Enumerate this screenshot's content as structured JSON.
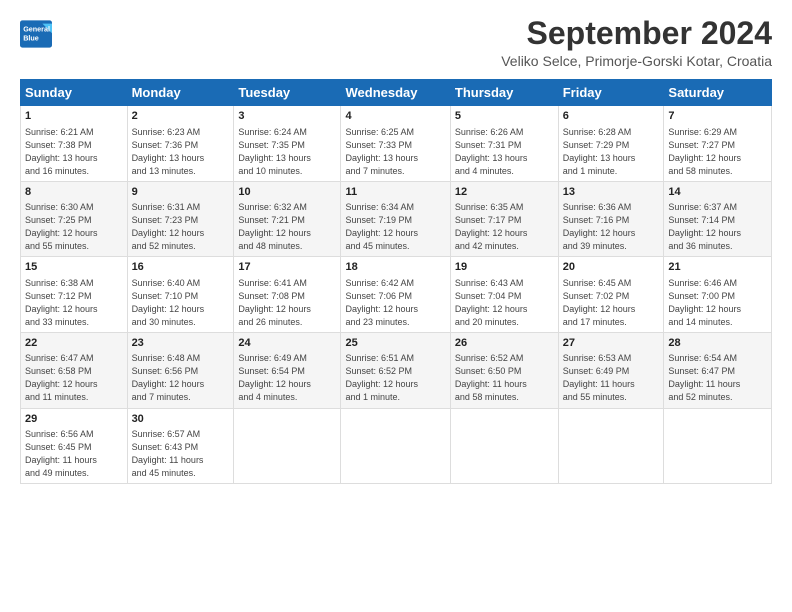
{
  "header": {
    "logo_line1": "General",
    "logo_line2": "Blue",
    "month_title": "September 2024",
    "location": "Veliko Selce, Primorje-Gorski Kotar, Croatia"
  },
  "days_of_week": [
    "Sunday",
    "Monday",
    "Tuesday",
    "Wednesday",
    "Thursday",
    "Friday",
    "Saturday"
  ],
  "weeks": [
    [
      {
        "day": "1",
        "info": "Sunrise: 6:21 AM\nSunset: 7:38 PM\nDaylight: 13 hours\nand 16 minutes."
      },
      {
        "day": "2",
        "info": "Sunrise: 6:23 AM\nSunset: 7:36 PM\nDaylight: 13 hours\nand 13 minutes."
      },
      {
        "day": "3",
        "info": "Sunrise: 6:24 AM\nSunset: 7:35 PM\nDaylight: 13 hours\nand 10 minutes."
      },
      {
        "day": "4",
        "info": "Sunrise: 6:25 AM\nSunset: 7:33 PM\nDaylight: 13 hours\nand 7 minutes."
      },
      {
        "day": "5",
        "info": "Sunrise: 6:26 AM\nSunset: 7:31 PM\nDaylight: 13 hours\nand 4 minutes."
      },
      {
        "day": "6",
        "info": "Sunrise: 6:28 AM\nSunset: 7:29 PM\nDaylight: 13 hours\nand 1 minute."
      },
      {
        "day": "7",
        "info": "Sunrise: 6:29 AM\nSunset: 7:27 PM\nDaylight: 12 hours\nand 58 minutes."
      }
    ],
    [
      {
        "day": "8",
        "info": "Sunrise: 6:30 AM\nSunset: 7:25 PM\nDaylight: 12 hours\nand 55 minutes."
      },
      {
        "day": "9",
        "info": "Sunrise: 6:31 AM\nSunset: 7:23 PM\nDaylight: 12 hours\nand 52 minutes."
      },
      {
        "day": "10",
        "info": "Sunrise: 6:32 AM\nSunset: 7:21 PM\nDaylight: 12 hours\nand 48 minutes."
      },
      {
        "day": "11",
        "info": "Sunrise: 6:34 AM\nSunset: 7:19 PM\nDaylight: 12 hours\nand 45 minutes."
      },
      {
        "day": "12",
        "info": "Sunrise: 6:35 AM\nSunset: 7:17 PM\nDaylight: 12 hours\nand 42 minutes."
      },
      {
        "day": "13",
        "info": "Sunrise: 6:36 AM\nSunset: 7:16 PM\nDaylight: 12 hours\nand 39 minutes."
      },
      {
        "day": "14",
        "info": "Sunrise: 6:37 AM\nSunset: 7:14 PM\nDaylight: 12 hours\nand 36 minutes."
      }
    ],
    [
      {
        "day": "15",
        "info": "Sunrise: 6:38 AM\nSunset: 7:12 PM\nDaylight: 12 hours\nand 33 minutes."
      },
      {
        "day": "16",
        "info": "Sunrise: 6:40 AM\nSunset: 7:10 PM\nDaylight: 12 hours\nand 30 minutes."
      },
      {
        "day": "17",
        "info": "Sunrise: 6:41 AM\nSunset: 7:08 PM\nDaylight: 12 hours\nand 26 minutes."
      },
      {
        "day": "18",
        "info": "Sunrise: 6:42 AM\nSunset: 7:06 PM\nDaylight: 12 hours\nand 23 minutes."
      },
      {
        "day": "19",
        "info": "Sunrise: 6:43 AM\nSunset: 7:04 PM\nDaylight: 12 hours\nand 20 minutes."
      },
      {
        "day": "20",
        "info": "Sunrise: 6:45 AM\nSunset: 7:02 PM\nDaylight: 12 hours\nand 17 minutes."
      },
      {
        "day": "21",
        "info": "Sunrise: 6:46 AM\nSunset: 7:00 PM\nDaylight: 12 hours\nand 14 minutes."
      }
    ],
    [
      {
        "day": "22",
        "info": "Sunrise: 6:47 AM\nSunset: 6:58 PM\nDaylight: 12 hours\nand 11 minutes."
      },
      {
        "day": "23",
        "info": "Sunrise: 6:48 AM\nSunset: 6:56 PM\nDaylight: 12 hours\nand 7 minutes."
      },
      {
        "day": "24",
        "info": "Sunrise: 6:49 AM\nSunset: 6:54 PM\nDaylight: 12 hours\nand 4 minutes."
      },
      {
        "day": "25",
        "info": "Sunrise: 6:51 AM\nSunset: 6:52 PM\nDaylight: 12 hours\nand 1 minute."
      },
      {
        "day": "26",
        "info": "Sunrise: 6:52 AM\nSunset: 6:50 PM\nDaylight: 11 hours\nand 58 minutes."
      },
      {
        "day": "27",
        "info": "Sunrise: 6:53 AM\nSunset: 6:49 PM\nDaylight: 11 hours\nand 55 minutes."
      },
      {
        "day": "28",
        "info": "Sunrise: 6:54 AM\nSunset: 6:47 PM\nDaylight: 11 hours\nand 52 minutes."
      }
    ],
    [
      {
        "day": "29",
        "info": "Sunrise: 6:56 AM\nSunset: 6:45 PM\nDaylight: 11 hours\nand 49 minutes."
      },
      {
        "day": "30",
        "info": "Sunrise: 6:57 AM\nSunset: 6:43 PM\nDaylight: 11 hours\nand 45 minutes."
      },
      {
        "day": "",
        "info": ""
      },
      {
        "day": "",
        "info": ""
      },
      {
        "day": "",
        "info": ""
      },
      {
        "day": "",
        "info": ""
      },
      {
        "day": "",
        "info": ""
      }
    ]
  ]
}
